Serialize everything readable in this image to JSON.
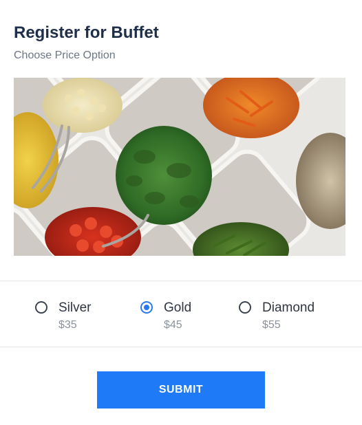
{
  "form": {
    "title": "Register for Buffet",
    "subtitle": "Choose Price Option",
    "image_alt": "Buffet trays with vegetables, corn, tomatoes, greens, peppers and mushrooms"
  },
  "options": [
    {
      "label": "Silver",
      "price": "$35",
      "selected": false
    },
    {
      "label": "Gold",
      "price": "$45",
      "selected": true
    },
    {
      "label": "Diamond",
      "price": "$55",
      "selected": false
    }
  ],
  "submit_label": "SUBMIT",
  "colors": {
    "accent": "#1f7af7",
    "title": "#1f2e4a",
    "muted": "#8a929e"
  }
}
